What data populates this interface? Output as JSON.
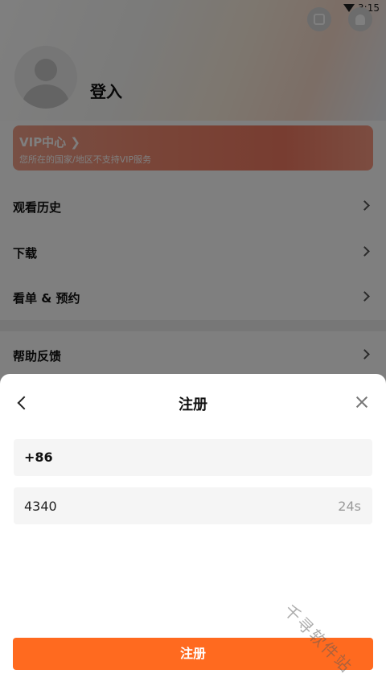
{
  "status_bar": {
    "time": "3:15",
    "wifi_icon": "wifi-icon"
  },
  "profile": {
    "login_label": "登入",
    "avatar_icon": "person-icon"
  },
  "header_actions": {
    "scan_icon": "scan-icon",
    "bell_icon": "bell-icon"
  },
  "vip": {
    "title": "VIP中心 ❯",
    "subtitle": "您所在的国家/地区不支持VIP服务",
    "colors": {
      "start": "#f0a08a",
      "end": "#f17a62"
    }
  },
  "menu": [
    {
      "label": "观看历史"
    },
    {
      "label": "下载"
    },
    {
      "label": "看单 & 预约"
    },
    {
      "label": "帮助反馈"
    }
  ],
  "sheet": {
    "title": "注册",
    "phone": {
      "country_code": "+86"
    },
    "code": {
      "value": "4340",
      "countdown": "24s"
    },
    "submit_label": "注册",
    "accent_color": "#ff6a1f"
  },
  "watermark": "千寻软件站"
}
